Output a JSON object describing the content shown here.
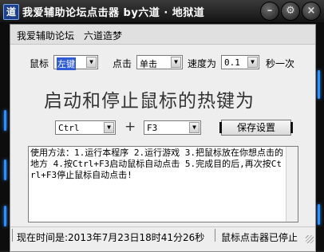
{
  "window": {
    "title": "我爱辅助论坛点击器   by六道 · 地狱道",
    "icon_letter": "道"
  },
  "title_buttons": {
    "minimize": "–",
    "settings": "⚙",
    "close": "×"
  },
  "header": {
    "link1": "我爱辅助论坛",
    "link2": "六道造梦"
  },
  "controls": {
    "mouse_label": "鼠标",
    "mouse_value": "左键",
    "click_label": "点击",
    "click_value": "单击",
    "speed_label": "速度为",
    "speed_value": "0.1",
    "speed_unit": "秒一次"
  },
  "hotkey": {
    "heading": "启动和停止鼠标的热键为",
    "modifier_value": "Ctrl",
    "plus": "+",
    "key_value": "F3",
    "save_label": "保存设置"
  },
  "instructions": "使用方法：1.运行本程序 2.运行游戏 3.把鼠标放在你想点击的地方 4.按Ctrl+F3启动鼠标自动点击 5.完成目的后,再次按Ctrl+F3停止鼠标自动点击!",
  "status": {
    "time_text": "现在时间是:2013年7月23日18时41分26秒",
    "state_text": "鼠标点击器已停止"
  },
  "colors": {
    "accent": "#2e8fff",
    "selection": "#2f5bd6",
    "frame": "#121212"
  }
}
